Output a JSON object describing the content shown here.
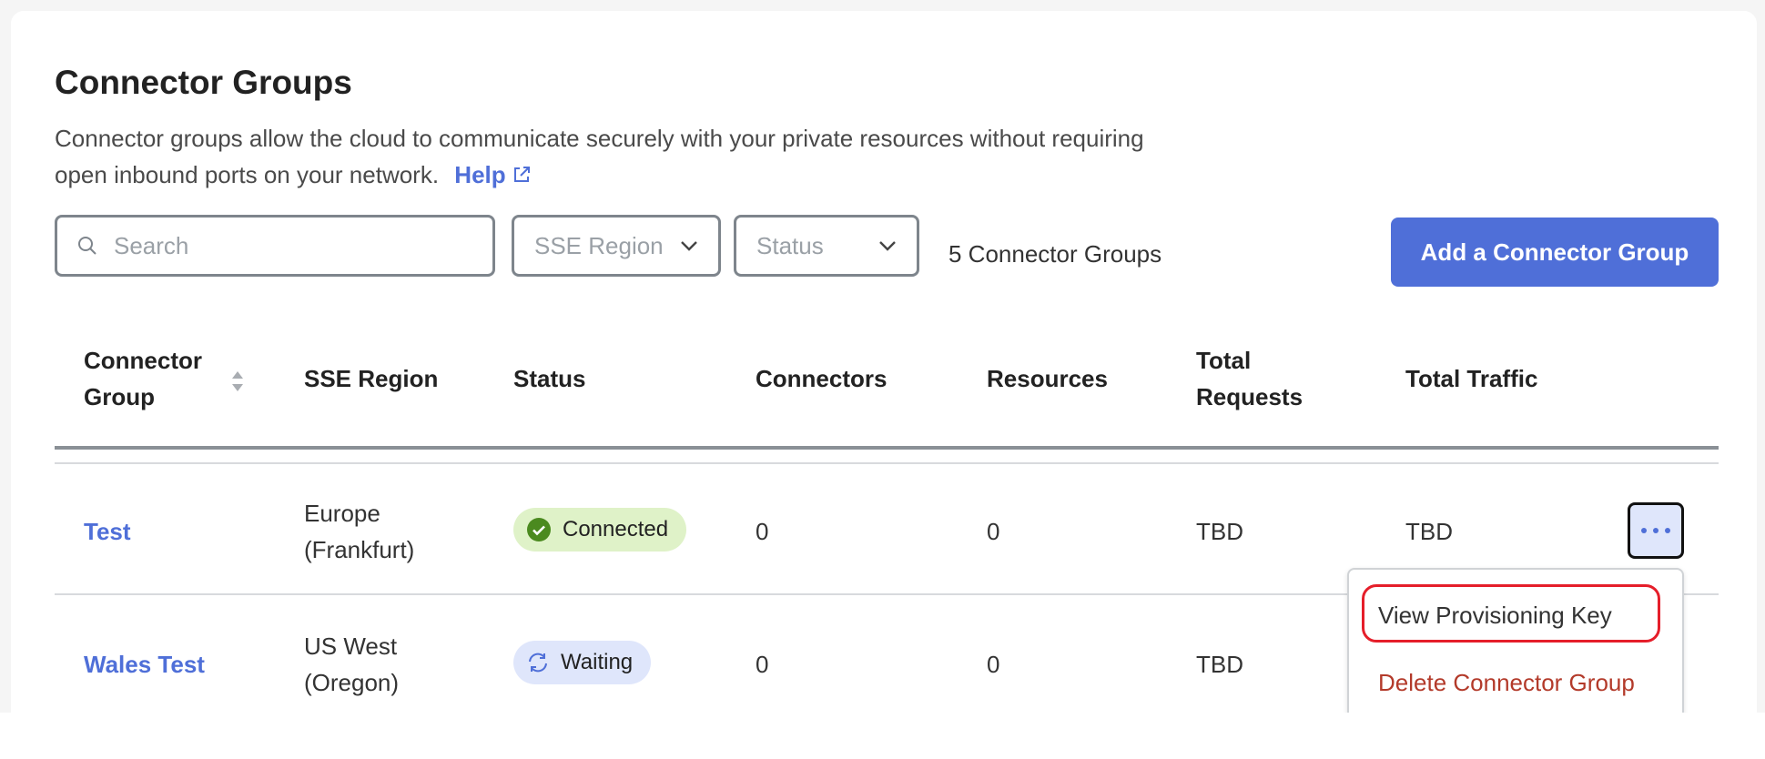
{
  "page": {
    "title": "Connector Groups",
    "description": "Connector groups allow the cloud to communicate securely with your private resources without requiring open inbound ports on your network.",
    "help_label": "Help",
    "external_link_icon": "external-link-icon"
  },
  "toolbar": {
    "search_placeholder": "Search",
    "search_value": "",
    "region_select": "SSE Region",
    "status_select": "Status",
    "count_text": "5 Connector Groups",
    "add_button": "Add a Connector Group"
  },
  "table": {
    "headers": {
      "group_line1": "Connector",
      "group_line2": "Group",
      "region": "SSE Region",
      "status": "Status",
      "connectors": "Connectors",
      "resources": "Resources",
      "requests_line1": "Total",
      "requests_line2": "Requests",
      "traffic": "Total Traffic"
    },
    "rows": [
      {
        "name": "Test",
        "region_line1": "Europe",
        "region_line2": "(Frankfurt)",
        "status": "Connected",
        "connectors": "0",
        "resources": "0",
        "requests": "TBD",
        "traffic": "TBD"
      },
      {
        "name": "Wales Test",
        "region_line1": "US West",
        "region_line2": "(Oregon)",
        "status": "Waiting",
        "connectors": "0",
        "resources": "0",
        "requests": "TBD",
        "traffic": ""
      }
    ]
  },
  "row_menu": {
    "view_key": "View Provisioning Key",
    "delete": "Delete Connector Group"
  },
  "colors": {
    "accent": "#4f6fd8",
    "connected_bg": "#dff2c8",
    "connected_icon": "#4b8a1f",
    "waiting_bg": "#dfe6fb",
    "danger": "#b33a2a",
    "highlight": "#e51e2a"
  }
}
